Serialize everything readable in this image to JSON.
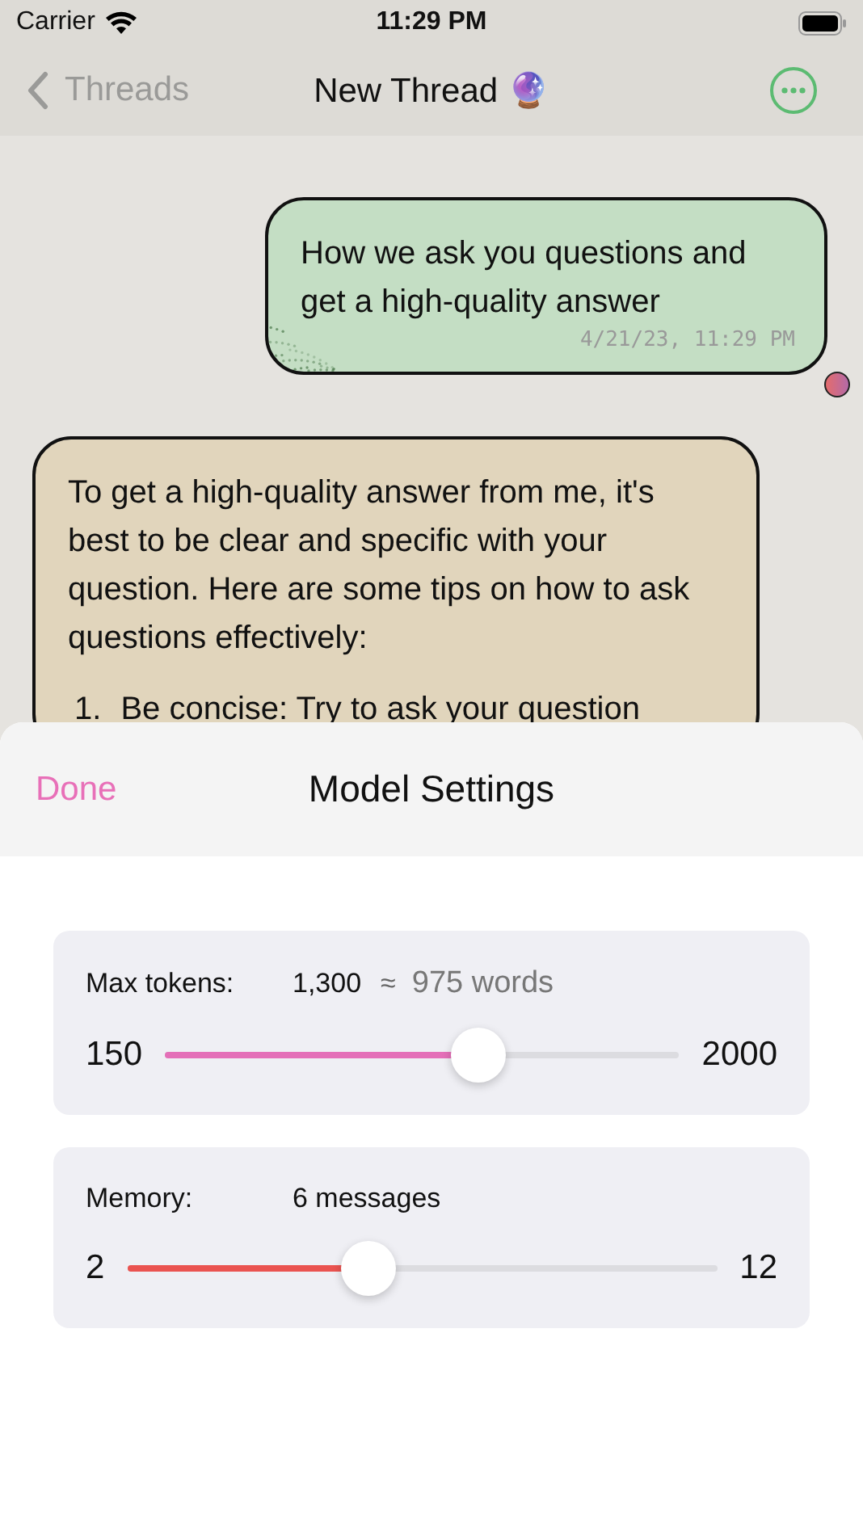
{
  "status_bar": {
    "carrier": "Carrier",
    "time": "11:29 PM"
  },
  "nav": {
    "back": "Threads",
    "title": "New Thread 🔮"
  },
  "messages": [
    {
      "kind": "user",
      "text": "How we ask you questions and get a high-quality answer",
      "time": "4/21/23, 11:29 PM"
    },
    {
      "kind": "assistant",
      "text": "To get a high-quality answer from me, it's best to be clear and specific with your question. Here are some tips on how to ask questions effectively:",
      "list": [
        {
          "number": "1.",
          "text": "Be concise: Try to ask your question"
        }
      ]
    }
  ],
  "sheet": {
    "done": "Done",
    "title": "Model Settings",
    "settings": [
      {
        "label": "Max tokens:",
        "value": "1,300",
        "approx": "≈",
        "approx_value": "975 words",
        "min": "150",
        "max": "2000",
        "level": 0.61,
        "color": "#e46fb8"
      },
      {
        "label": "Memory:",
        "value": "6 messages",
        "min": "2",
        "max": "12",
        "level": 0.41,
        "color": "#ea5350"
      }
    ]
  }
}
